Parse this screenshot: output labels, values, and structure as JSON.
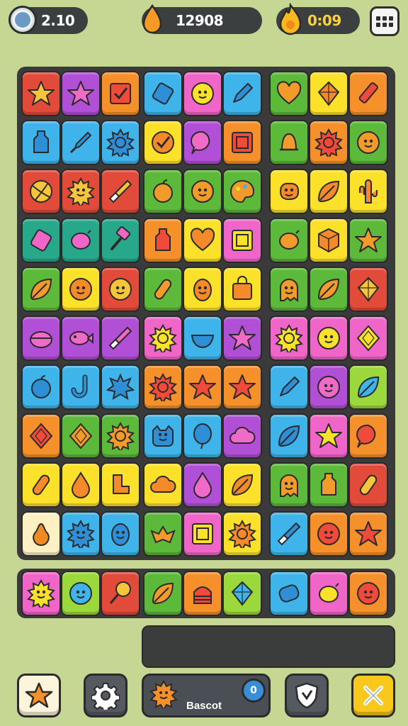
{
  "hud": {
    "moves": "2.10",
    "score": "12908",
    "timer": "0:09",
    "timer_icon": "flame-icon",
    "menu_icon": "grid-menu-icon"
  },
  "colors": {
    "red": "#e24a3a",
    "purple": "#b14fd6",
    "orange": "#f5902a",
    "blue": "#3fb4ea",
    "yellow": "#fbe12a",
    "green": "#5cb93a",
    "pink": "#f066c8",
    "teal": "#27a88a",
    "cream": "#fdf1c4",
    "lime": "#9ad83b"
  },
  "board": {
    "rows": [
      [
        [
          "red",
          "star-icon"
        ],
        [
          "purple",
          "star-icon"
        ],
        [
          "orange",
          "checkbox-icon"
        ],
        [
          "blue",
          "eraser-icon"
        ],
        [
          "pink",
          "face-icon"
        ],
        [
          "blue",
          "pencil-icon"
        ],
        [
          "green",
          "heart-icon"
        ],
        [
          "yellow",
          "gem-icon"
        ],
        [
          "orange",
          "pen-icon"
        ]
      ],
      [
        [
          "blue",
          "bottle-icon"
        ],
        [
          "blue",
          "rocket-icon"
        ],
        [
          "blue",
          "sun-icon"
        ],
        [
          "yellow",
          "check-circle-icon"
        ],
        [
          "purple",
          "bubble-icon"
        ],
        [
          "orange",
          "frame-icon"
        ],
        [
          "green",
          "bell-icon"
        ],
        [
          "orange",
          "sun-icon"
        ],
        [
          "green",
          "face-icon"
        ]
      ],
      [
        [
          "red",
          "ball-icon"
        ],
        [
          "red",
          "sun-face-icon"
        ],
        [
          "red",
          "brush-icon"
        ],
        [
          "green",
          "apple-icon"
        ],
        [
          "green",
          "face-icon"
        ],
        [
          "green",
          "palette-icon"
        ],
        [
          "yellow",
          "blob-icon"
        ],
        [
          "yellow",
          "leaf-icon"
        ],
        [
          "yellow",
          "cactus-icon"
        ]
      ],
      [
        [
          "teal",
          "eraser-icon"
        ],
        [
          "teal",
          "lemon-icon"
        ],
        [
          "teal",
          "hammer-icon"
        ],
        [
          "orange",
          "bottle-icon"
        ],
        [
          "yellow",
          "heart-icon"
        ],
        [
          "pink",
          "frame-icon"
        ],
        [
          "green",
          "lemon-icon"
        ],
        [
          "yellow",
          "cube-icon"
        ],
        [
          "green",
          "star-icon"
        ]
      ],
      [
        [
          "green",
          "leaf-icon"
        ],
        [
          "yellow",
          "face-icon"
        ],
        [
          "red",
          "face-icon"
        ],
        [
          "green",
          "crayon-icon"
        ],
        [
          "yellow",
          "egg-icon"
        ],
        [
          "yellow",
          "bag-icon"
        ],
        [
          "green",
          "ghost-icon"
        ],
        [
          "green",
          "leaf-icon"
        ],
        [
          "red",
          "gem-icon"
        ]
      ],
      [
        [
          "purple",
          "melon-icon"
        ],
        [
          "purple",
          "fish-icon"
        ],
        [
          "purple",
          "brush-icon"
        ],
        [
          "pink",
          "sun-icon"
        ],
        [
          "blue",
          "bowl-icon"
        ],
        [
          "purple",
          "star-icon"
        ],
        [
          "pink",
          "sun-icon"
        ],
        [
          "pink",
          "face-icon"
        ],
        [
          "pink",
          "diamond-icon"
        ]
      ],
      [
        [
          "blue",
          "apple-icon"
        ],
        [
          "blue",
          "hook-icon"
        ],
        [
          "blue",
          "burst-icon"
        ],
        [
          "orange",
          "sun-icon"
        ],
        [
          "orange",
          "star-icon"
        ],
        [
          "orange",
          "star-icon"
        ],
        [
          "blue",
          "pencil-icon"
        ],
        [
          "purple",
          "face-icon"
        ],
        [
          "lime",
          "leaf-icon"
        ]
      ],
      [
        [
          "orange",
          "diamond-icon"
        ],
        [
          "green",
          "diamond-icon"
        ],
        [
          "green",
          "sun-icon"
        ],
        [
          "blue",
          "cat-icon"
        ],
        [
          "blue",
          "balloon-icon"
        ],
        [
          "purple",
          "cloud-icon"
        ],
        [
          "blue",
          "leaf-icon"
        ],
        [
          "pink",
          "star-icon"
        ],
        [
          "orange",
          "bubble-icon"
        ]
      ],
      [
        [
          "yellow",
          "crayon-icon"
        ],
        [
          "yellow",
          "drop-icon"
        ],
        [
          "yellow",
          "boot-icon"
        ],
        [
          "yellow",
          "cloud-icon"
        ],
        [
          "purple",
          "drop-icon"
        ],
        [
          "yellow",
          "leaf-icon"
        ],
        [
          "green",
          "ghost-icon"
        ],
        [
          "green",
          "bottle-icon"
        ],
        [
          "red",
          "crayon-icon"
        ]
      ],
      [
        [
          "cream",
          "pear-icon"
        ],
        [
          "blue",
          "sun-face-icon"
        ],
        [
          "blue",
          "egg-icon"
        ],
        [
          "green",
          "bat-icon"
        ],
        [
          "pink",
          "frame-icon"
        ],
        [
          "yellow",
          "sun-icon"
        ],
        [
          "blue",
          "brush-icon"
        ],
        [
          "orange",
          "face-icon"
        ],
        [
          "orange",
          "star-icon"
        ]
      ]
    ]
  },
  "tray": [
    [
      "pink",
      "sun-face-icon"
    ],
    [
      "lime",
      "face-icon"
    ],
    [
      "red",
      "lollipop-icon"
    ],
    [
      "green",
      "leaf-icon"
    ],
    [
      "orange",
      "cake-icon"
    ],
    [
      "lime",
      "gem-icon"
    ],
    [
      "blue",
      "marshmallow-icon"
    ],
    [
      "pink",
      "lemon-icon"
    ],
    [
      "orange",
      "face-icon"
    ]
  ],
  "bottom": {
    "basket_label": "Bascot",
    "basket_count": "0",
    "buttons": [
      "star-icon",
      "gear-icon",
      "shield-icon",
      "close-icon"
    ]
  }
}
